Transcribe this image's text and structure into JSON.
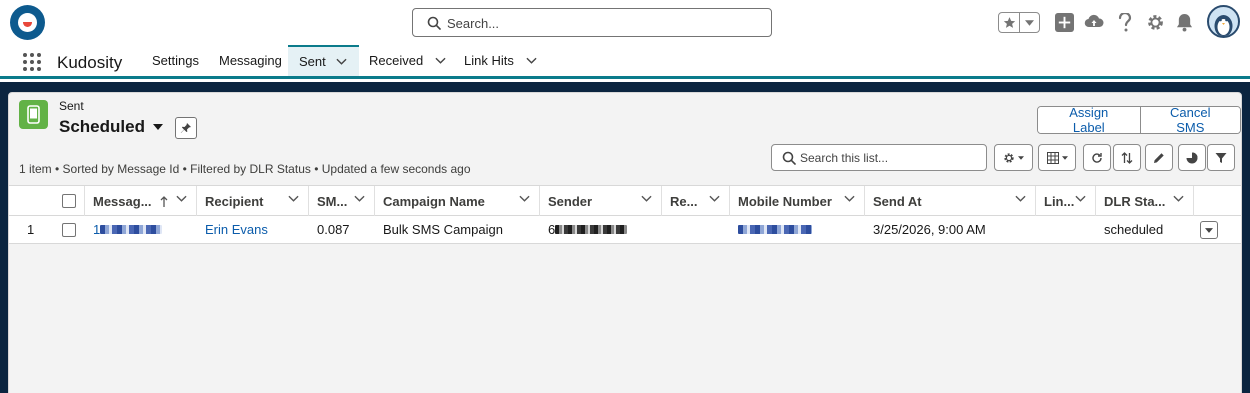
{
  "header": {
    "search_placeholder": "Search..."
  },
  "nav": {
    "app_name": "Kudosity",
    "items": [
      {
        "label": "Settings"
      },
      {
        "label": "Messaging"
      },
      {
        "label": "Sent"
      },
      {
        "label": "Received"
      },
      {
        "label": "Link Hits"
      }
    ]
  },
  "list_view": {
    "object_label": "Sent",
    "title": "Scheduled",
    "meta": "1 item • Sorted by Message Id • Filtered by DLR Status • Updated a few seconds ago",
    "search_placeholder": "Search this list...",
    "actions": {
      "assign_label": "Assign Label",
      "cancel_sms": "Cancel SMS"
    }
  },
  "table": {
    "columns": [
      {
        "label": "Messag..."
      },
      {
        "label": "Recipient"
      },
      {
        "label": "SM..."
      },
      {
        "label": "Campaign Name"
      },
      {
        "label": "Sender"
      },
      {
        "label": "Re..."
      },
      {
        "label": "Mobile Number"
      },
      {
        "label": "Send At"
      },
      {
        "label": "Lin..."
      },
      {
        "label": "DLR Sta..."
      }
    ],
    "rows": [
      {
        "index": "1",
        "message_id_prefix": "1",
        "recipient": "Erin Evans",
        "sms_cost": "0.087",
        "campaign_name": "Bulk SMS Campaign",
        "sender_prefix": "6",
        "reply": "",
        "send_at": "3/25/2026, 9:00 AM",
        "link_hits": "",
        "dlr_status": "scheduled"
      }
    ]
  },
  "colors": {
    "brand_teal": "#0b7b8b",
    "link_blue": "#0b5cab",
    "backdrop": "#0b2540",
    "object_icon_green": "#62b246"
  }
}
